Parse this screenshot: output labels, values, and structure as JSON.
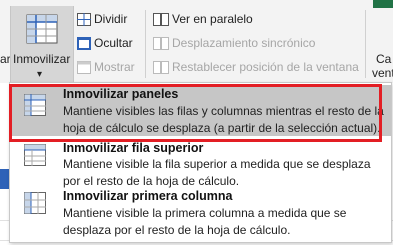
{
  "ribbon": {
    "immovilizar_label": "Inmovilizar",
    "caret": "▾",
    "left_cut_label": "ar",
    "dividir_label": "Dividir",
    "ocultar_label": "Ocultar",
    "mostrar_label": "Mostrar",
    "ver_paralelo_label": "Ver en paralelo",
    "desplazamiento_label": "Desplazamiento sincrónico",
    "restablecer_label": "Restablecer posición de la ventana",
    "right_cut_line1": "Ca",
    "right_cut_line2": "vent"
  },
  "menu": {
    "items": [
      {
        "title": "Inmovilizar paneles",
        "description": "Mantiene visibles las filas y columnas mientras el resto de la hoja de cálculo se desplaza (a partir de la selección actual).",
        "icon": "freeze-panes-icon"
      },
      {
        "title": "Inmovilizar fila superior",
        "description": "Mantiene visible la fila superior a medida que se desplaza por el resto de la hoja de cálculo.",
        "icon": "freeze-top-row-icon"
      },
      {
        "title": "Inmovilizar primera columna",
        "description": "Mantiene visible la primera columna a medida que se desplaza por el resto de la hoja de cálculo.",
        "icon": "freeze-first-column-icon"
      }
    ]
  },
  "colors": {
    "highlight": "#c6c6c6",
    "annotation_red": "#e31e24",
    "accent_blue": "#2e62b8",
    "excel_green": "#217346"
  }
}
